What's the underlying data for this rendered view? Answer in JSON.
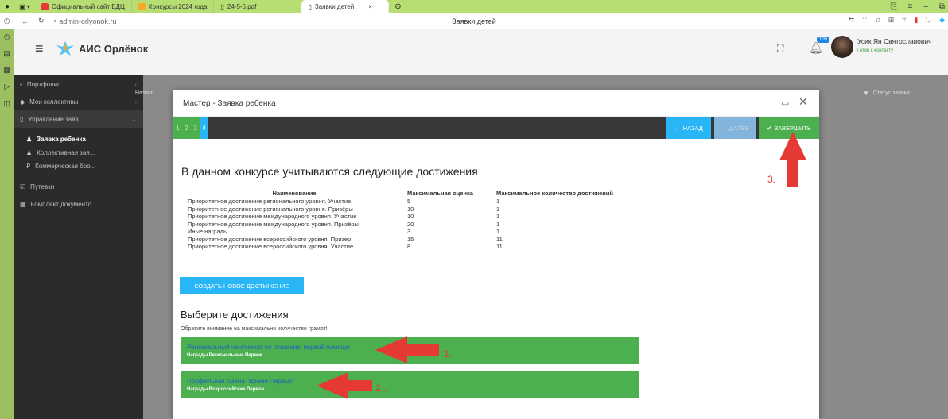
{
  "browser": {
    "tabs": [
      {
        "label": "Официальный сайт БДЦ"
      },
      {
        "label": "Конкурсы 2024 года"
      },
      {
        "label": "24-5-6.pdf"
      },
      {
        "label": "Заявки детей"
      }
    ],
    "url": "admin-orlyonok.ru",
    "page_title": "Заявки детей"
  },
  "header": {
    "app_title": "АИС Орлёнок",
    "notification_count": "105",
    "user_name": "Усик Ян Святославович",
    "user_status": "Готов к контакту"
  },
  "sidebar": {
    "items": [
      {
        "label": "Портфолио"
      },
      {
        "label": "Мои коллективы"
      },
      {
        "label": "Управление заяв..."
      },
      {
        "label": "Заявка ребенка"
      },
      {
        "label": "Коллективная зая..."
      },
      {
        "label": "Коммерческая бро..."
      },
      {
        "label": "Путевки"
      },
      {
        "label": "Комплект документо..."
      }
    ]
  },
  "content": {
    "col_name": "Назван",
    "col_status": "Статус заявки"
  },
  "modal": {
    "title": "Мастер - Заявка ребенка",
    "steps": [
      "1",
      "2",
      "3",
      "4"
    ],
    "btn_back": "НАЗАД",
    "btn_next": "ДАЛЕЕ",
    "btn_finish": "ЗАВЕРШИТЬ",
    "section_title": "В данном конкурсе учитываются следующие достижения",
    "table": {
      "headers": [
        "Наименование",
        "Максимальная оценка",
        "Максимальное количество достижений"
      ],
      "rows": [
        [
          "Приоритетное достижение регионального уровня. Участие",
          "5",
          "1"
        ],
        [
          "Приоритетное достижение регионального уровня. Призёры",
          "10",
          "1"
        ],
        [
          "Приоритетное достижение международного уровня. Участие",
          "10",
          "1"
        ],
        [
          "Приоритетное достижение международного уровня. Призёры",
          "20",
          "1"
        ],
        [
          "Иные награды.",
          "3",
          "1"
        ],
        [
          "Приоритетное достижение всероссийского уровня. Призер",
          "15",
          "11"
        ],
        [
          "Приоритетное достижение всероссийского уровня. Участие",
          "8",
          "11"
        ]
      ]
    },
    "create_button": "СОЗДАТЬ НОВОЕ ДОСТИЖЕНИЕ",
    "choose_title": "Выберите достижения",
    "choose_note": "Обратите внимание на максимально количество грамот!",
    "achievements": [
      {
        "title": "Региональный чемпионат по оказанию первой помощи",
        "meta": "Награды Региональные Первое"
      },
      {
        "title": "Профильная смена \"Время Первых\"",
        "meta": "Награды Всероссийские Первое"
      }
    ]
  },
  "annotations": [
    "1.",
    "2....",
    "3."
  ],
  "colors": {
    "tab_bar": "#b7de73",
    "accent_blue": "#29b6f6",
    "accent_green": "#4caf50",
    "sidebar_bg": "#2b2b2b",
    "annotation_red": "#e53935"
  }
}
